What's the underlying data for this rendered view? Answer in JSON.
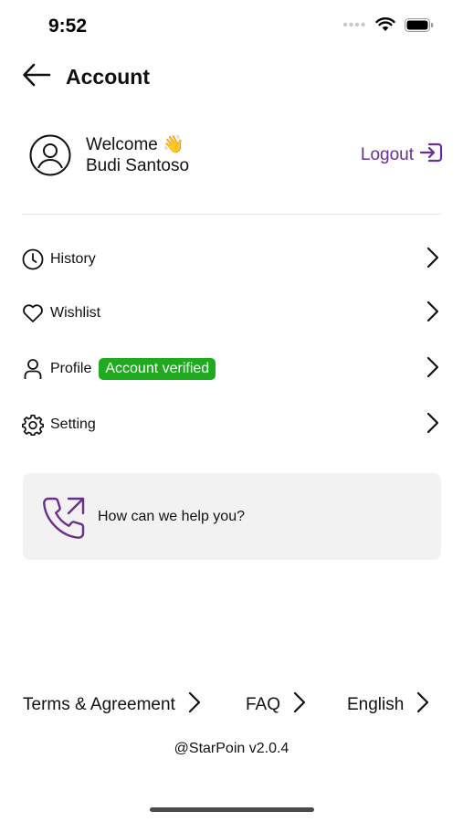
{
  "status_bar": {
    "time": "9:52",
    "icons": [
      "signal-dots-icon",
      "wifi-icon",
      "battery-icon"
    ]
  },
  "header": {
    "back_icon": "arrow-left-icon",
    "title": "Account"
  },
  "user": {
    "avatar_icon": "user-circle-icon",
    "welcome": "Welcome 👋",
    "name": "Budi Santoso",
    "logout_label": "Logout",
    "logout_icon": "logout-icon"
  },
  "menu": {
    "items": [
      {
        "label": "History",
        "icon": "clock-icon"
      },
      {
        "label": "Wishlist",
        "icon": "heart-icon"
      },
      {
        "label": "Profile",
        "icon": "person-icon",
        "badge": "Account verified"
      },
      {
        "label": "Setting",
        "icon": "gear-icon"
      }
    ]
  },
  "help": {
    "icon": "phone-outgoing-icon",
    "text": "How can we help you?"
  },
  "footer": {
    "links": [
      "Terms & Agreement",
      "FAQ",
      "English"
    ],
    "version": "@StarPoin v2.0.4"
  },
  "colors": {
    "accent": "#6B2E91",
    "verified_badge": "#1FAA1F",
    "help_card_bg": "#f2f2f2"
  }
}
